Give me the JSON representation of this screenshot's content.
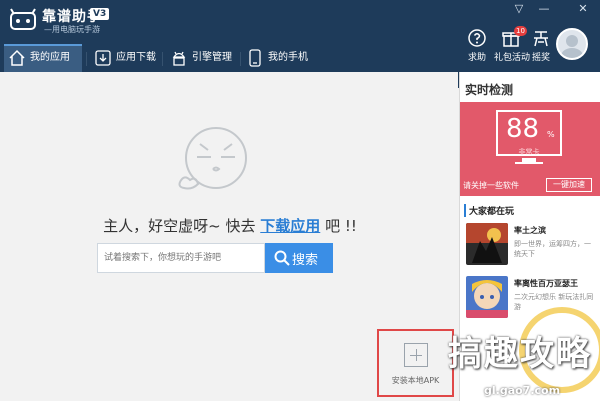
{
  "app": {
    "brand": "靠谱助手",
    "version": "V3",
    "tagline": "—用电脑玩手游"
  },
  "window_controls": {
    "skin": "▽",
    "minimize": "—",
    "close": "✕"
  },
  "toolbar": {
    "help_label": "求助",
    "gifts_label": "礼包活动",
    "gifts_badge": "10",
    "ads_label": "摇奖"
  },
  "nav": {
    "tabs": [
      {
        "label": "我的应用",
        "icon": "home-icon"
      },
      {
        "label": "应用下载",
        "icon": "download-icon"
      },
      {
        "label": "引擎管理",
        "icon": "android-icon"
      },
      {
        "label": "我的手机",
        "icon": "phone-icon"
      }
    ]
  },
  "main": {
    "empty_prefix": "主人，好空虚呀~ 快去",
    "empty_link": "下载应用",
    "empty_suffix": "吧 !!",
    "search_placeholder": "试着搜索下，你想玩的手游吧",
    "search_button": "搜索",
    "install_apk_label": "安装本地APK"
  },
  "side": {
    "title": "实时检测",
    "score": "88",
    "score_unit": "%",
    "state": "非常卡",
    "tip": "请关掉一些软件",
    "boost_button": "一键加速",
    "section_title": "大家都在玩",
    "games": [
      {
        "name": "率土之滨",
        "desc": "即一世界，运筹四方，一统天下"
      },
      {
        "name": "率离性百万亚瑟王",
        "desc": "二次元幻想乐 新玩法扎同游"
      }
    ]
  },
  "watermark": {
    "text": "搞趣攻略",
    "url": "gl.gao7.com"
  },
  "colors": {
    "titlebar": "#1e3b5a",
    "accent": "#3a8ee6",
    "monitor": "#e2596a",
    "highlight": "#e04848"
  }
}
